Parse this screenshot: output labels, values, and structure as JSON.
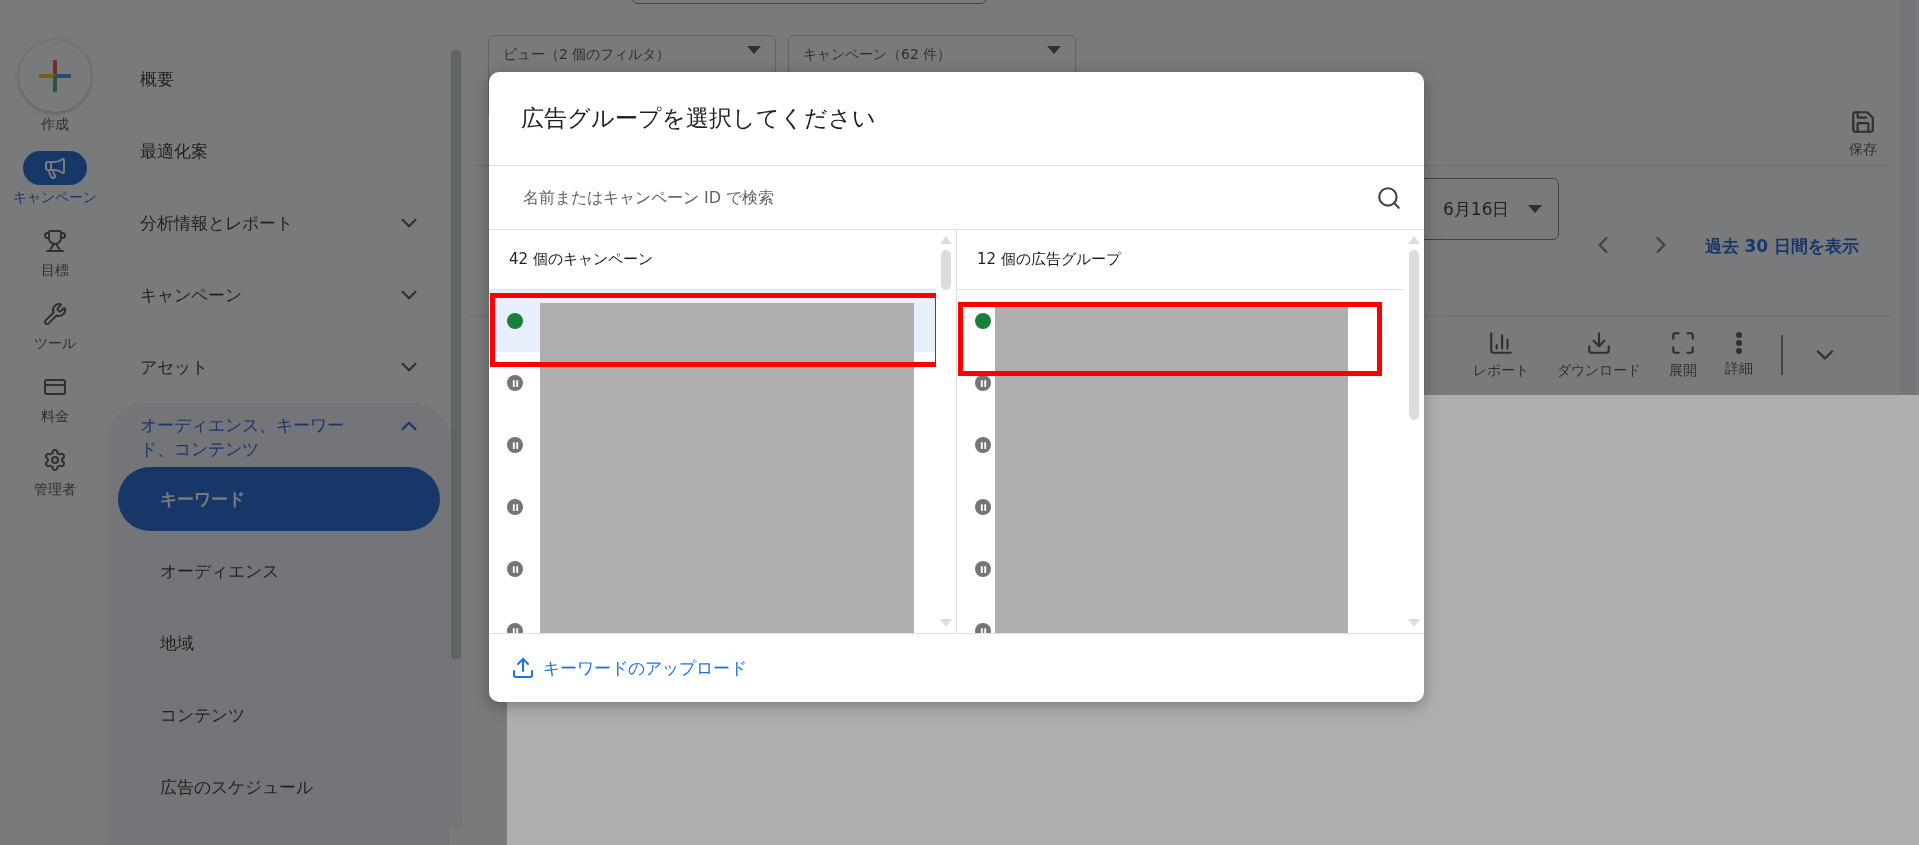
{
  "rail": [
    {
      "label": "作成",
      "kind": "create",
      "selected": false
    },
    {
      "label": "キャンペーン",
      "kind": "campaigns",
      "selected": true
    },
    {
      "label": "目標",
      "kind": "goals",
      "selected": false
    },
    {
      "label": "ツール",
      "kind": "tools",
      "selected": false
    },
    {
      "label": "料金",
      "kind": "billing",
      "selected": false
    },
    {
      "label": "管理者",
      "kind": "admin",
      "selected": false
    }
  ],
  "nav": [
    {
      "label": "概要",
      "kind": "link"
    },
    {
      "label": "最適化案",
      "kind": "link"
    },
    {
      "label": "分析情報とレポート",
      "kind": "group",
      "expanded": false
    },
    {
      "label": "キャンペーン",
      "kind": "group",
      "expanded": false
    },
    {
      "label": "アセット",
      "kind": "group",
      "expanded": false
    },
    {
      "label": "オーディエンス、キーワード、コンテンツ",
      "kind": "group",
      "expanded": true,
      "children": [
        {
          "label": "キーワード",
          "selected": true
        },
        {
          "label": "オーディエンス",
          "selected": false
        },
        {
          "label": "地域",
          "selected": false
        },
        {
          "label": "コンテンツ",
          "selected": false
        },
        {
          "label": "広告のスケジュール",
          "selected": false
        }
      ]
    }
  ],
  "filters": [
    {
      "label": "ビュー（2 個のフィルタ）"
    },
    {
      "label": "キャンペーン（62 件）"
    }
  ],
  "save": "保存",
  "date": "6月16日",
  "date_link": "過去 30 日間を表示",
  "toolbar": [
    {
      "label": "レポート",
      "kind": "report"
    },
    {
      "label": "ダウンロード",
      "kind": "download"
    },
    {
      "label": "展開",
      "kind": "expand"
    },
    {
      "label": "詳細",
      "kind": "more"
    }
  ],
  "dialog": {
    "title": "広告グループを選択してください",
    "search_placeholder": "名前またはキャンペーン ID で検索",
    "panes": [
      {
        "header": "42 個のキャンペーン",
        "rows": [
          {
            "kind": "active",
            "selected": true,
            "highlighted": true
          },
          {
            "kind": "paused",
            "selected": false,
            "highlighted": false
          },
          {
            "kind": "paused",
            "selected": false,
            "highlighted": false
          },
          {
            "kind": "paused",
            "selected": false,
            "highlighted": false
          },
          {
            "kind": "paused",
            "selected": false,
            "highlighted": false
          },
          {
            "kind": "paused",
            "selected": false,
            "highlighted": false
          }
        ]
      },
      {
        "header": "12 個の広告グループ",
        "rows": [
          {
            "kind": "active",
            "selected": false,
            "highlighted": true
          },
          {
            "kind": "paused",
            "selected": false,
            "highlighted": false
          },
          {
            "kind": "paused",
            "selected": false,
            "highlighted": false
          },
          {
            "kind": "paused",
            "selected": false,
            "highlighted": false
          },
          {
            "kind": "paused",
            "selected": false,
            "highlighted": false
          },
          {
            "kind": "paused",
            "selected": false,
            "highlighted": false
          }
        ]
      }
    ],
    "footer_link": "キーワードのアップロード"
  }
}
